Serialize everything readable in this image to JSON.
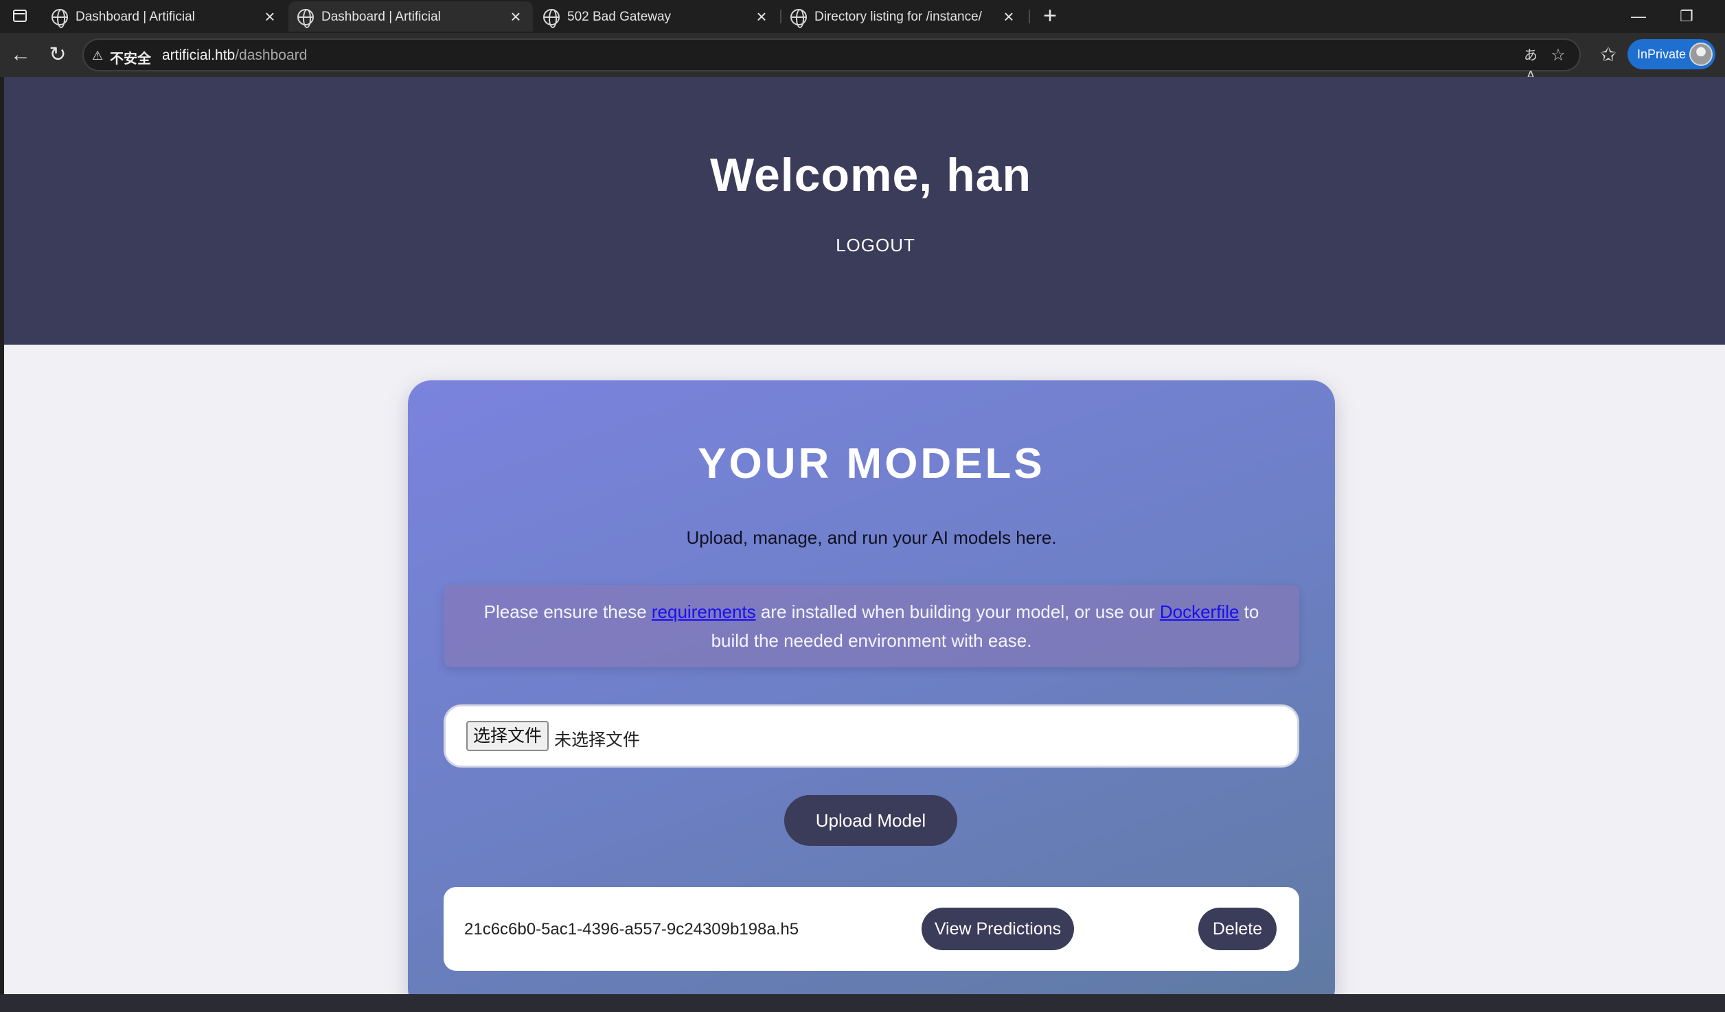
{
  "browser": {
    "tabs": [
      {
        "title": "Dashboard | Artificial",
        "active": false
      },
      {
        "title": "Dashboard | Artificial",
        "active": true
      },
      {
        "title": "502 Bad Gateway",
        "active": false
      },
      {
        "title": "Directory listing for /instance/",
        "active": false
      }
    ],
    "security_label": "不安全",
    "url_host": "artificial.htb",
    "url_path": "/dashboard",
    "inprivate_label": "InPrivate",
    "translate_icon_text": "あA"
  },
  "hero": {
    "welcome": "Welcome, han",
    "logout": "LOGOUT",
    "bg_color": "#3b3b5a"
  },
  "models": {
    "title": "YOUR MODELS",
    "subtitle": "Upload, manage, and run your AI models here.",
    "notice_pre": "Please ensure these ",
    "requirements_link": "requirements",
    "notice_mid": " are installed when building your model, or use our ",
    "dockerfile_link": "Dockerfile",
    "notice_post": " to build the needed environment with ease.",
    "file_button": "选择文件",
    "file_status": "未选择文件",
    "upload_button": "Upload Model",
    "items": [
      {
        "name": "21c6c6b0-5ac1-4396-a557-9c24309b198a.h5",
        "view_label": "View Predictions",
        "delete_label": "Delete"
      }
    ]
  }
}
